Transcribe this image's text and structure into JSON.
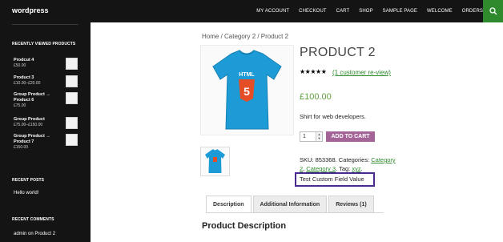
{
  "header": {
    "site_title": "wordpress",
    "nav": [
      "MY ACCOUNT",
      "CHECKOUT",
      "CART",
      "SHOP",
      "SAMPLE PAGE",
      "WELCOME",
      "ORDERS"
    ],
    "colors": {
      "bar": "#141414",
      "search": "#2e8a2c"
    }
  },
  "sidebar": {
    "recently_viewed": {
      "heading": "RECENTLY VIEWED PRODUCTS",
      "items": [
        {
          "name": "Prodcut 4",
          "price": "£50.00"
        },
        {
          "name": "Product 3",
          "price": "£10.00–£20.00"
        },
        {
          "name": "Group Product → Product 6",
          "price": "£75.00"
        },
        {
          "name": "Group Product",
          "price": "£75.00–£150.00"
        },
        {
          "name": "Group Product → Product 7",
          "price": "£150.00"
        }
      ]
    },
    "recent_posts": {
      "heading": "RECENT POSTS",
      "items": [
        "Hello world!"
      ]
    },
    "recent_comments": {
      "heading": "RECENT COMMENTS",
      "author": "admin",
      "connector": "on",
      "post": "Product 2"
    }
  },
  "breadcrumb": "Home / Category 2 / Product 2",
  "product": {
    "title": "PRODUCT 2",
    "stars": "★★★★★",
    "review_link": "(1 customer re-view)",
    "price": "£100.00",
    "short_description": "Shirt for web developers.",
    "quantity": "1",
    "add_to_cart": "ADD TO CART",
    "meta": {
      "sku_label": "SKU: 853368.",
      "categories_label": "Categories:",
      "category_a": "Category 2",
      "category_b": "Category 3",
      "tag_label": "Tag:",
      "tag": "xyz"
    },
    "custom_field": "Test Custom Field Value",
    "colors": {
      "price": "#5fa13e",
      "button": "#a46497",
      "link": "#2e8a2c",
      "highlight": "#4b2a8f"
    }
  },
  "tabs": [
    "Description",
    "Additional Information",
    "Reviews (1)"
  ],
  "description_heading": "Product Description"
}
